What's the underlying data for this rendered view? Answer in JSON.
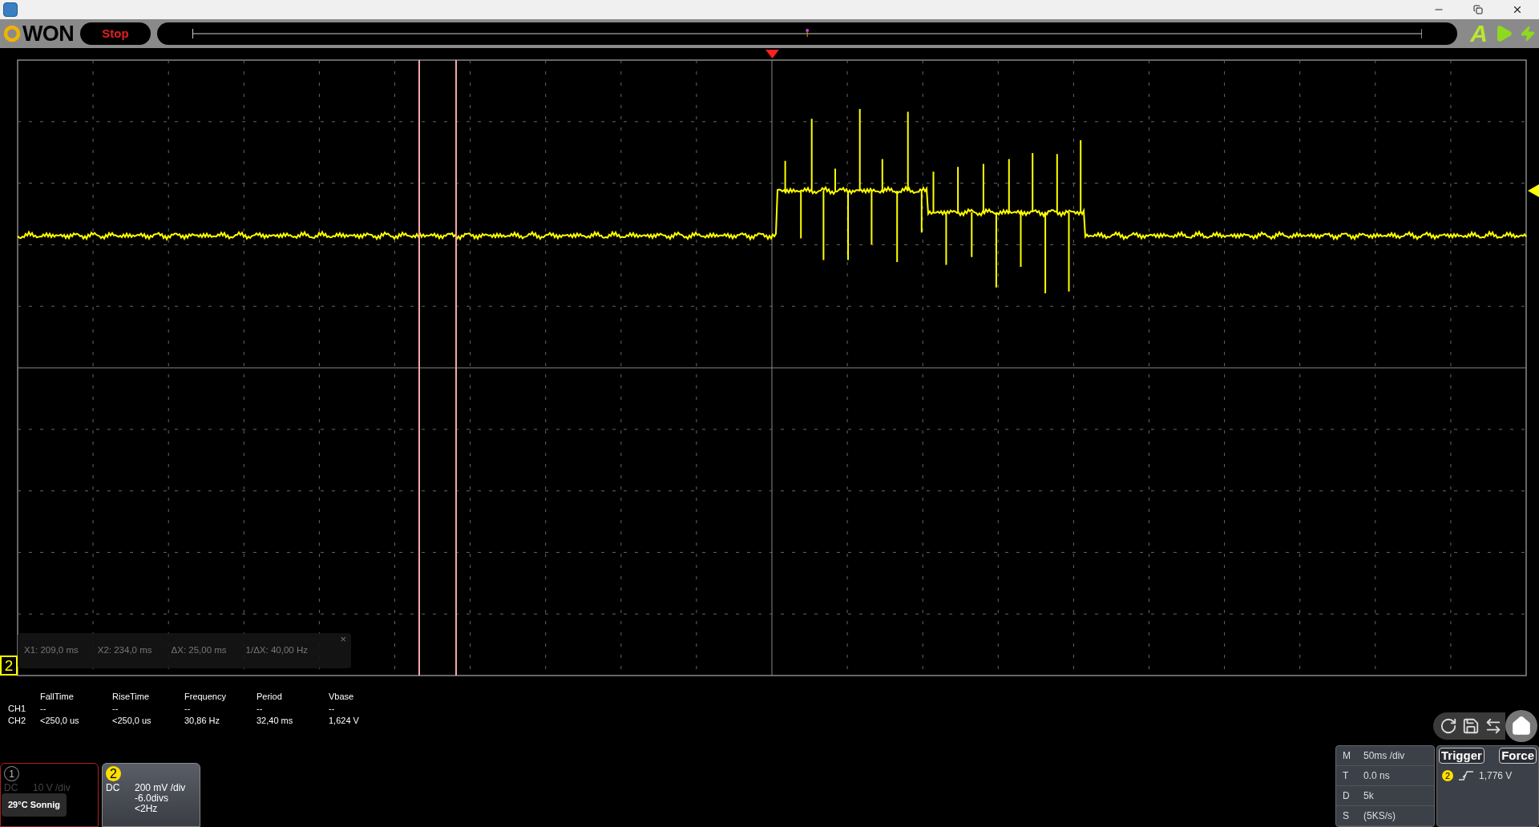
{
  "toolbar": {
    "logo": "WON",
    "run_state": "Stop",
    "auto_button": "A"
  },
  "cursor_readout": {
    "items": [
      "X1: 209,0 ms",
      "X2: 234,0 ms",
      "ΔX: 25,00 ms",
      "1/ΔX: 40,00 Hz"
    ],
    "close": "×"
  },
  "channel_marker": "2",
  "measurements": {
    "columns": [
      "FallTime",
      "RiseTime",
      "Frequency",
      "Period",
      "Vbase"
    ],
    "rows": [
      {
        "label": "CH1",
        "values": [
          "--",
          "--",
          "--",
          "--",
          "--"
        ]
      },
      {
        "label": "CH2",
        "values": [
          "<250,0 us",
          "<250,0 us",
          "30,86 Hz",
          "32,40 ms",
          "1,624 V"
        ]
      }
    ]
  },
  "channels": [
    {
      "number": "1",
      "active": false,
      "lines": [
        "DC",
        "10 V /div"
      ]
    },
    {
      "number": "2",
      "active": true,
      "lines": [
        "DC",
        "200 mV /div",
        "-6.0divs",
        "<2Hz"
      ]
    }
  ],
  "tooltip": "29°C Sonnig",
  "timebase": [
    {
      "key": "M",
      "value": "50ms /div"
    },
    {
      "key": "T",
      "value": "0.0 ns"
    },
    {
      "key": "D",
      "value": "5k"
    },
    {
      "key": "S",
      "value": "(5KS/s)"
    }
  ],
  "trigger": {
    "buttons": [
      "Trigger",
      "Force"
    ],
    "source": "2",
    "level": "1,776 V"
  }
}
